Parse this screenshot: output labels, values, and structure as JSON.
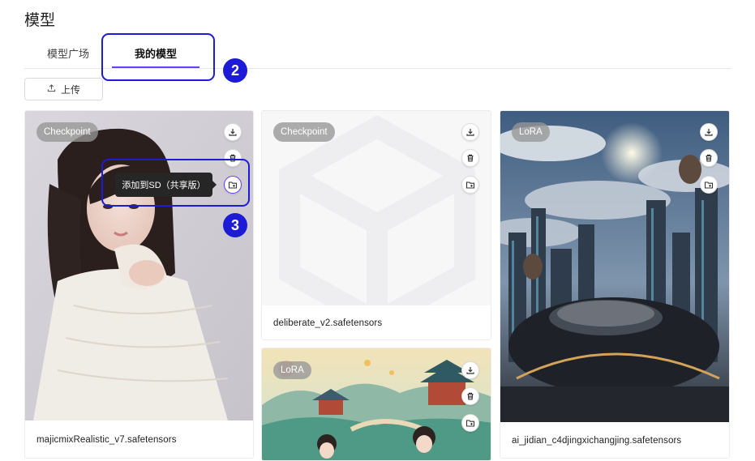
{
  "page": {
    "title": "模型"
  },
  "tabs": [
    {
      "label": "模型广场",
      "active": false
    },
    {
      "label": "我的模型",
      "active": true
    }
  ],
  "toolbar": {
    "upload_label": "上传",
    "upload_icon": "upload-icon"
  },
  "callouts": {
    "step_tabs": "2",
    "step_add": "3"
  },
  "tooltip": {
    "text": "添加到SD（共享版）"
  },
  "cards": [
    {
      "type": "Checkpoint",
      "name": "majicmixRealistic_v7.safetensors",
      "image": "portrait-woman-white-sweater"
    },
    {
      "type": "Checkpoint",
      "name": "deliberate_v2.safetensors",
      "image": "placeholder-cube"
    },
    {
      "type": "LoRA",
      "name": "ai_jidian_c4djingxichangjing.safetensors",
      "image": "futuristic-city-clouds"
    },
    {
      "type": "LoRA",
      "name": "",
      "image": "chinese-pavilion-illustration"
    }
  ],
  "card_actions": {
    "download": "download-icon",
    "delete": "trash-icon",
    "add": "folder-add-icon"
  },
  "colors": {
    "accent": "#6b3df5",
    "annotation": "#1d1bd6",
    "tooltip_bg": "#262626"
  }
}
